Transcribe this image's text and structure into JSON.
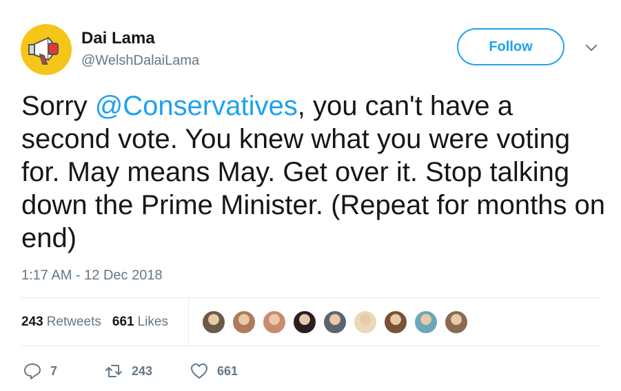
{
  "user": {
    "name": "Dai Lama",
    "handle": "@WelshDalaiLama"
  },
  "follow_label": "Follow",
  "tweet": {
    "text_before": "Sorry ",
    "mention": "@Conservatives",
    "text_after": ", you can't have a second vote. You knew what you were voting for. May means May. Get over it. Stop talking down the Prime Minister. (Repeat for months on end)"
  },
  "timestamp": "1:17 AM - 12 Dec 2018",
  "stats": {
    "retweets_count": "243",
    "retweets_label": "Retweets",
    "likes_count": "661",
    "likes_label": "Likes"
  },
  "likers": [
    {
      "color": "#6b5a4a"
    },
    {
      "color": "#b07a5a"
    },
    {
      "color": "#c98b6e"
    },
    {
      "color": "#2a1e20"
    },
    {
      "color": "#5c6470"
    },
    {
      "color": "#e9d9b8"
    },
    {
      "color": "#7a5236"
    },
    {
      "color": "#6aa7b8"
    },
    {
      "color": "#8a6a50"
    }
  ],
  "actions": {
    "reply_count": "7",
    "retweet_count": "243",
    "like_count": "661"
  },
  "icons": {
    "avatar": "megaphone-icon",
    "chevron": "chevron-down-icon",
    "reply": "reply-icon",
    "retweet": "retweet-icon",
    "like": "heart-icon"
  },
  "colors": {
    "accent": "#1da1f2",
    "secondary_text": "#657786",
    "avatar_bg": "#f5c518"
  }
}
